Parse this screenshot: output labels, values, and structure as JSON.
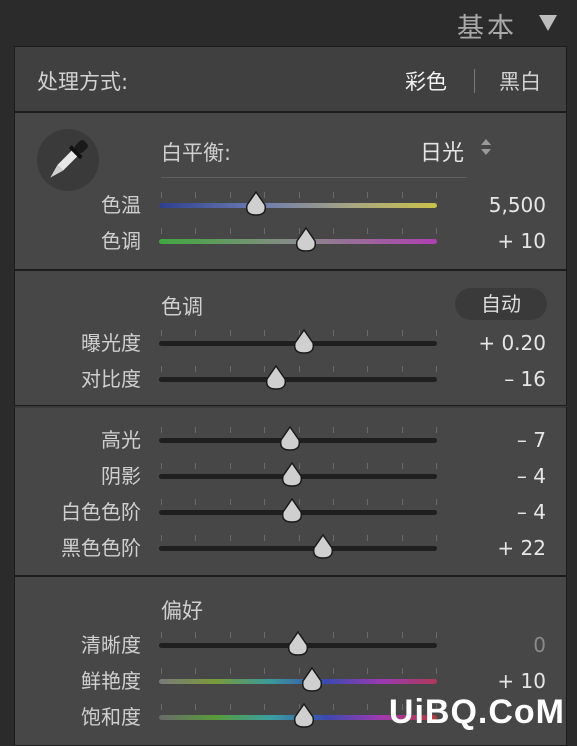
{
  "header": {
    "title": "基本"
  },
  "treatment": {
    "label": "处理方式:",
    "color": "彩色",
    "bw": "黑白"
  },
  "white_balance": {
    "label": "白平衡:",
    "value": "日光",
    "rows": [
      {
        "label": "色温",
        "value": "5,500",
        "position": 0.35
      },
      {
        "label": "色调",
        "value": "+ 10",
        "position": 0.53
      }
    ]
  },
  "tone": {
    "title": "色调",
    "auto": "自动",
    "rows": [
      {
        "label": "曝光度",
        "value": "+ 0.20",
        "position": 0.52
      },
      {
        "label": "对比度",
        "value": "– 16",
        "position": 0.42
      }
    ],
    "rows2": [
      {
        "label": "高光",
        "value": "– 7",
        "position": 0.47
      },
      {
        "label": "阴影",
        "value": "– 4",
        "position": 0.48
      },
      {
        "label": "白色色阶",
        "value": "– 4",
        "position": 0.48
      },
      {
        "label": "黑色色阶",
        "value": "+ 22",
        "position": 0.59
      }
    ]
  },
  "presence": {
    "title": "偏好",
    "rows": [
      {
        "label": "清晰度",
        "value": "0",
        "position": 0.5
      },
      {
        "label": "鲜艳度",
        "value": "+ 10",
        "position": 0.55
      },
      {
        "label": "饱和度",
        "value": "",
        "position": 0.52
      }
    ]
  },
  "watermark": {
    "text": "UiBQ.CoM"
  }
}
